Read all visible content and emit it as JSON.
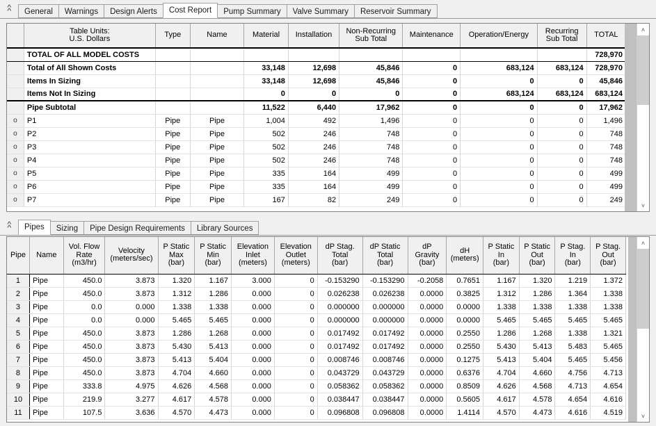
{
  "top_tabs": {
    "collapse_label": "collapse",
    "items": [
      {
        "label": "General",
        "active": false
      },
      {
        "label": "Warnings",
        "active": false
      },
      {
        "label": "Design Alerts",
        "active": false
      },
      {
        "label": "Cost Report",
        "active": true
      },
      {
        "label": "Pump Summary",
        "active": false
      },
      {
        "label": "Valve Summary",
        "active": false
      },
      {
        "label": "Reservoir Summary",
        "active": false
      }
    ]
  },
  "cost_report": {
    "headers": {
      "units_line1": "Table Units:",
      "units_line2": "U.S. Dollars",
      "type": "Type",
      "name": "Name",
      "material": "Material",
      "installation": "Installation",
      "non_recurring_1": "Non-Recurring",
      "non_recurring_2": "Sub Total",
      "maintenance": "Maintenance",
      "operation_energy": "Operation/Energy",
      "recurring_1": "Recurring",
      "recurring_2": "Sub Total",
      "total": "TOTAL"
    },
    "summary_rows": [
      {
        "marker": "",
        "label": "TOTAL OF ALL MODEL COSTS",
        "type": "",
        "name": "",
        "material": "",
        "installation": "",
        "nonrecur": "",
        "maintenance": "",
        "operation": "",
        "recurring": "",
        "total": "728,970",
        "style": "grand"
      },
      {
        "marker": "",
        "label": "Total of All Shown Costs",
        "type": "",
        "name": "",
        "material": "33,148",
        "installation": "12,698",
        "nonrecur": "45,846",
        "maintenance": "0",
        "operation": "683,124",
        "recurring": "683,124",
        "total": "728,970",
        "style": "bold"
      },
      {
        "marker": "",
        "label": "Items In Sizing",
        "type": "",
        "name": "",
        "material": "33,148",
        "installation": "12,698",
        "nonrecur": "45,846",
        "maintenance": "0",
        "operation": "0",
        "recurring": "0",
        "total": "45,846",
        "style": "bold"
      },
      {
        "marker": "",
        "label": "Items Not In Sizing",
        "type": "",
        "name": "",
        "material": "0",
        "installation": "0",
        "nonrecur": "0",
        "maintenance": "0",
        "operation": "683,124",
        "recurring": "683,124",
        "total": "683,124",
        "style": "bold"
      },
      {
        "marker": "",
        "label": "Pipe Subtotal",
        "type": "",
        "name": "",
        "material": "11,522",
        "installation": "6,440",
        "nonrecur": "17,962",
        "maintenance": "0",
        "operation": "0",
        "recurring": "0",
        "total": "17,962",
        "style": "bold heavy-top"
      }
    ],
    "item_rows": [
      {
        "marker": "o",
        "label": "P1",
        "type": "Pipe",
        "name": "Pipe",
        "material": "1,004",
        "installation": "492",
        "nonrecur": "1,496",
        "maintenance": "0",
        "operation": "0",
        "recurring": "0",
        "total": "1,496"
      },
      {
        "marker": "o",
        "label": "P2",
        "type": "Pipe",
        "name": "Pipe",
        "material": "502",
        "installation": "246",
        "nonrecur": "748",
        "maintenance": "0",
        "operation": "0",
        "recurring": "0",
        "total": "748"
      },
      {
        "marker": "o",
        "label": "P3",
        "type": "Pipe",
        "name": "Pipe",
        "material": "502",
        "installation": "246",
        "nonrecur": "748",
        "maintenance": "0",
        "operation": "0",
        "recurring": "0",
        "total": "748"
      },
      {
        "marker": "o",
        "label": "P4",
        "type": "Pipe",
        "name": "Pipe",
        "material": "502",
        "installation": "246",
        "nonrecur": "748",
        "maintenance": "0",
        "operation": "0",
        "recurring": "0",
        "total": "748"
      },
      {
        "marker": "o",
        "label": "P5",
        "type": "Pipe",
        "name": "Pipe",
        "material": "335",
        "installation": "164",
        "nonrecur": "499",
        "maintenance": "0",
        "operation": "0",
        "recurring": "0",
        "total": "499"
      },
      {
        "marker": "o",
        "label": "P6",
        "type": "Pipe",
        "name": "Pipe",
        "material": "335",
        "installation": "164",
        "nonrecur": "499",
        "maintenance": "0",
        "operation": "0",
        "recurring": "0",
        "total": "499"
      },
      {
        "marker": "o",
        "label": "P7",
        "type": "Pipe",
        "name": "Pipe",
        "material": "167",
        "installation": "82",
        "nonrecur": "249",
        "maintenance": "0",
        "operation": "0",
        "recurring": "0",
        "total": "249"
      }
    ],
    "scrollbar": {
      "up": "˄",
      "down": "˅"
    }
  },
  "bottom_tabs": {
    "items": [
      {
        "label": "Pipes",
        "active": true
      },
      {
        "label": "Sizing",
        "active": false
      },
      {
        "label": "Pipe Design Requirements",
        "active": false
      },
      {
        "label": "Library Sources",
        "active": false
      }
    ]
  },
  "pipes_table": {
    "columns": [
      {
        "l1": "",
        "l2": "Pipe",
        "l3": ""
      },
      {
        "l1": "Name",
        "l2": "",
        "l3": ""
      },
      {
        "l1": "Vol. Flow",
        "l2": "Rate",
        "l3": "(m3/hr)"
      },
      {
        "l1": "Velocity",
        "l2": "",
        "l3": "(meters/sec)"
      },
      {
        "l1": "P Static",
        "l2": "Max",
        "l3": "(bar)"
      },
      {
        "l1": "P Static",
        "l2": "Min",
        "l3": "(bar)"
      },
      {
        "l1": "Elevation",
        "l2": "Inlet",
        "l3": "(meters)"
      },
      {
        "l1": "Elevation",
        "l2": "Outlet",
        "l3": "(meters)"
      },
      {
        "l1": "dP Stag.",
        "l2": "Total",
        "l3": "(bar)"
      },
      {
        "l1": "dP Static",
        "l2": "Total",
        "l3": "(bar)"
      },
      {
        "l1": "dP",
        "l2": "Gravity",
        "l3": "(bar)"
      },
      {
        "l1": "dH",
        "l2": "",
        "l3": "(meters)"
      },
      {
        "l1": "P Static",
        "l2": "In",
        "l3": "(bar)"
      },
      {
        "l1": "P Static",
        "l2": "Out",
        "l3": "(bar)"
      },
      {
        "l1": "P Stag.",
        "l2": "In",
        "l3": "(bar)"
      },
      {
        "l1": "P Stag.",
        "l2": "Out",
        "l3": "(bar)"
      }
    ],
    "rows": [
      [
        "1",
        "Pipe",
        "450.0",
        "3.873",
        "1.320",
        "1.167",
        "3.000",
        "0",
        "-0.153290",
        "-0.153290",
        "-0.2058",
        "0.7651",
        "1.167",
        "1.320",
        "1.219",
        "1.372"
      ],
      [
        "2",
        "Pipe",
        "450.0",
        "3.873",
        "1.312",
        "1.286",
        "0.000",
        "0",
        "0.026238",
        "0.026238",
        "0.0000",
        "0.3825",
        "1.312",
        "1.286",
        "1.364",
        "1.338"
      ],
      [
        "3",
        "Pipe",
        "0.0",
        "0.000",
        "1.338",
        "1.338",
        "0.000",
        "0",
        "0.000000",
        "0.000000",
        "0.0000",
        "0.0000",
        "1.338",
        "1.338",
        "1.338",
        "1.338"
      ],
      [
        "4",
        "Pipe",
        "0.0",
        "0.000",
        "5.465",
        "5.465",
        "0.000",
        "0",
        "0.000000",
        "0.000000",
        "0.0000",
        "0.0000",
        "5.465",
        "5.465",
        "5.465",
        "5.465"
      ],
      [
        "5",
        "Pipe",
        "450.0",
        "3.873",
        "1.286",
        "1.268",
        "0.000",
        "0",
        "0.017492",
        "0.017492",
        "0.0000",
        "0.2550",
        "1.286",
        "1.268",
        "1.338",
        "1.321"
      ],
      [
        "6",
        "Pipe",
        "450.0",
        "3.873",
        "5.430",
        "5.413",
        "0.000",
        "0",
        "0.017492",
        "0.017492",
        "0.0000",
        "0.2550",
        "5.430",
        "5.413",
        "5.483",
        "5.465"
      ],
      [
        "7",
        "Pipe",
        "450.0",
        "3.873",
        "5.413",
        "5.404",
        "0.000",
        "0",
        "0.008746",
        "0.008746",
        "0.0000",
        "0.1275",
        "5.413",
        "5.404",
        "5.465",
        "5.456"
      ],
      [
        "8",
        "Pipe",
        "450.0",
        "3.873",
        "4.704",
        "4.660",
        "0.000",
        "0",
        "0.043729",
        "0.043729",
        "0.0000",
        "0.6376",
        "4.704",
        "4.660",
        "4.756",
        "4.713"
      ],
      [
        "9",
        "Pipe",
        "333.8",
        "4.975",
        "4.626",
        "4.568",
        "0.000",
        "0",
        "0.058362",
        "0.058362",
        "0.0000",
        "0.8509",
        "4.626",
        "4.568",
        "4.713",
        "4.654"
      ],
      [
        "10",
        "Pipe",
        "219.9",
        "3.277",
        "4.617",
        "4.578",
        "0.000",
        "0",
        "0.038447",
        "0.038447",
        "0.0000",
        "0.5605",
        "4.617",
        "4.578",
        "4.654",
        "4.616"
      ],
      [
        "11",
        "Pipe",
        "107.5",
        "3.636",
        "4.570",
        "4.473",
        "0.000",
        "0",
        "0.096808",
        "0.096808",
        "0.0000",
        "1.4114",
        "4.570",
        "4.473",
        "4.616",
        "4.519"
      ]
    ],
    "scrollbar": {
      "up": "˄",
      "down": "˅"
    }
  }
}
